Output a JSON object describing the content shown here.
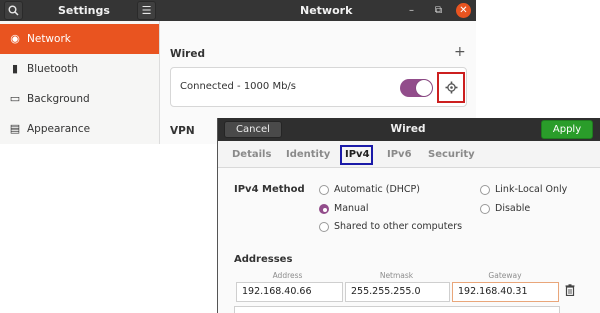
{
  "settings": {
    "title": "Settings",
    "panel_title": "Network",
    "sidebar": [
      {
        "label": "Network",
        "icon": "network-icon"
      },
      {
        "label": "Bluetooth",
        "icon": "bluetooth-icon"
      },
      {
        "label": "Background",
        "icon": "background-icon"
      },
      {
        "label": "Appearance",
        "icon": "appearance-icon"
      }
    ],
    "wired_heading": "Wired",
    "add_symbol": "+",
    "wired_status": "Connected - 1000 Mb/s",
    "wired_enabled": true,
    "vpn_heading": "VPN"
  },
  "dialog": {
    "title": "Wired",
    "cancel_label": "Cancel",
    "apply_label": "Apply",
    "tabs": [
      "Details",
      "Identity",
      "IPv4",
      "IPv6",
      "Security"
    ],
    "active_tab": "IPv4",
    "method_label": "IPv4 Method",
    "methods": {
      "dhcp": "Automatic (DHCP)",
      "manual": "Manual",
      "shared": "Shared to other computers",
      "link_local": "Link-Local Only",
      "disable": "Disable"
    },
    "selected_method": "Manual",
    "addresses_label": "Addresses",
    "columns": [
      "Address",
      "Netmask",
      "Gateway"
    ],
    "address_row": [
      "192.168.40.66",
      "255.255.255.0",
      "192.168.40.31"
    ]
  },
  "colors": {
    "accent_orange": "#e95420",
    "toggle_purple": "#924d8b",
    "apply_green": "#2a9d2a",
    "highlight_red": "#cc1f1f",
    "highlight_blue": "#1a1aa8"
  }
}
